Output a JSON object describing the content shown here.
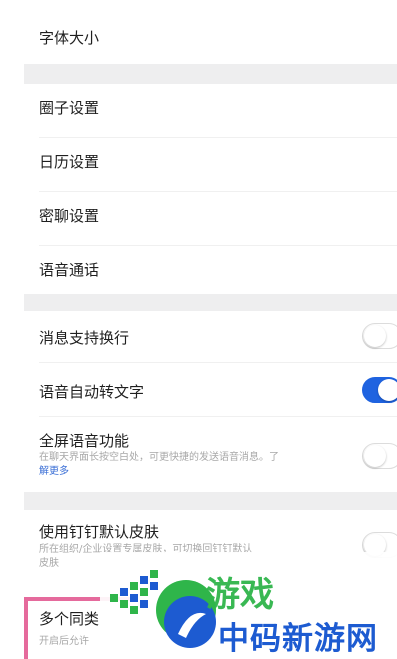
{
  "settings": {
    "font_size": "字体大小",
    "circle_settings": "圈子设置",
    "calendar_settings": "日历设置",
    "secret_chat_settings": "密聊设置",
    "voice_call": "语音通话",
    "message_wrap": "消息支持换行",
    "voice_to_text": "语音自动转文字",
    "fullscreen_voice": "全屏语音功能",
    "fullscreen_voice_desc": "在聊天界面长按空白处，可更快捷的发送语音消息。了",
    "learn_more": "解更多",
    "default_skin": "使用钉钉默认皮肤",
    "default_skin_desc": "所在组织/企业设置专属皮肤，可切换回钉钉默认",
    "default_skin_desc2": "皮肤",
    "multi_sync": "多个同类",
    "multi_sync_desc": "开启后允许"
  },
  "toggles": {
    "message_wrap": false,
    "voice_to_text": true,
    "fullscreen_voice": false,
    "default_skin": false
  },
  "watermark": {
    "cn_name": "中码新游网",
    "green_text": "游戏"
  },
  "colors": {
    "accent": "#1f63e0",
    "separator": "#eeeeef",
    "pink_highlight": "#e56a9c"
  }
}
